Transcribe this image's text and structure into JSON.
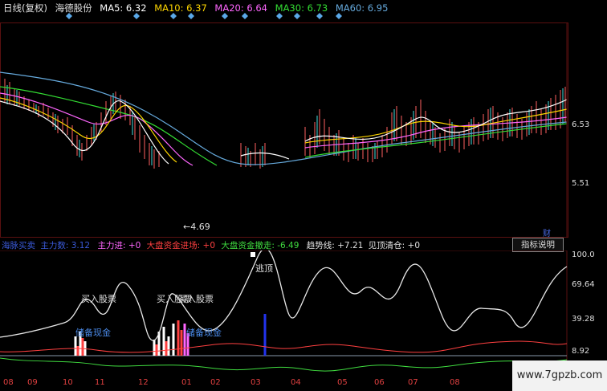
{
  "header": {
    "period": "日线(复权)",
    "stock": "海德股份",
    "ma": [
      {
        "label": "MA5: 6.32",
        "color": "#ffffff"
      },
      {
        "label": "MA10: 6.37",
        "color": "#ffd700"
      },
      {
        "label": "MA20: 6.64",
        "color": "#ff66ff"
      },
      {
        "label": "MA30: 6.73",
        "color": "#33dd33"
      },
      {
        "label": "MA60: 6.95",
        "color": "#66aadd"
      }
    ]
  },
  "price_axis": {
    "top_value": "6.53",
    "bottom_value": "5.51"
  },
  "annotations": {
    "low_marker": "←4.69",
    "cai": "财"
  },
  "indicator": {
    "items": [
      {
        "text": "海脉买卖",
        "color": "#3a5ad8"
      },
      {
        "text": "主力数: 3.12",
        "color": "#3a5ad8"
      },
      {
        "text": "主力进: +0",
        "color": "#ff66ff"
      },
      {
        "text": "大盘资金进场: +0",
        "color": "#ff4040"
      },
      {
        "text": "大盘资金撤走: -6.49",
        "color": "#40dd40"
      },
      {
        "text": "趋势线: +7.21",
        "color": "#e0e0e0"
      },
      {
        "text": "见顶清仓: +0",
        "color": "#e0e0e0"
      }
    ],
    "button": "指标说明",
    "axis": [
      "100.0",
      "69.64",
      "39.28",
      "8.92"
    ],
    "signals": {
      "buy1": "买入股票",
      "buy2": "买入股票",
      "buy3": "买入股票",
      "cash1": "储备现金",
      "cash2": "储备现金",
      "top": "逃顶"
    }
  },
  "date_axis": [
    "08",
    "09",
    "10",
    "11",
    "12",
    "01",
    "02",
    "03",
    "04",
    "05",
    "06",
    "07",
    "08"
  ],
  "watermark": "www.7gpzb.com"
}
